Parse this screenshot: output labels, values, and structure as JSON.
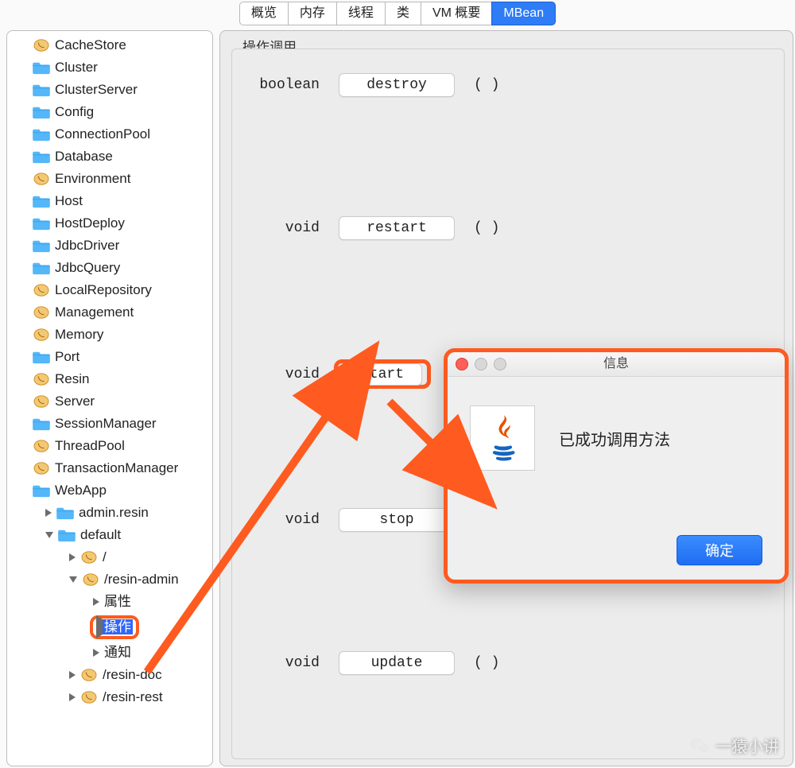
{
  "tabs": {
    "items": [
      "概览",
      "内存",
      "线程",
      "类",
      "VM 概要",
      "MBean"
    ],
    "active_index": 5
  },
  "sidebar": {
    "nodes": [
      {
        "depth": 1,
        "arrow": "none",
        "icon": "bean",
        "label": "CacheStore"
      },
      {
        "depth": 1,
        "arrow": "none",
        "icon": "folder",
        "label": "Cluster"
      },
      {
        "depth": 1,
        "arrow": "none",
        "icon": "folder",
        "label": "ClusterServer"
      },
      {
        "depth": 1,
        "arrow": "none",
        "icon": "folder",
        "label": "Config"
      },
      {
        "depth": 1,
        "arrow": "none",
        "icon": "folder",
        "label": "ConnectionPool"
      },
      {
        "depth": 1,
        "arrow": "none",
        "icon": "folder",
        "label": "Database"
      },
      {
        "depth": 1,
        "arrow": "none",
        "icon": "bean",
        "label": "Environment"
      },
      {
        "depth": 1,
        "arrow": "none",
        "icon": "folder",
        "label": "Host"
      },
      {
        "depth": 1,
        "arrow": "none",
        "icon": "folder",
        "label": "HostDeploy"
      },
      {
        "depth": 1,
        "arrow": "none",
        "icon": "folder",
        "label": "JdbcDriver"
      },
      {
        "depth": 1,
        "arrow": "none",
        "icon": "folder",
        "label": "JdbcQuery"
      },
      {
        "depth": 1,
        "arrow": "none",
        "icon": "bean",
        "label": "LocalRepository"
      },
      {
        "depth": 1,
        "arrow": "none",
        "icon": "bean",
        "label": "Management"
      },
      {
        "depth": 1,
        "arrow": "none",
        "icon": "bean",
        "label": "Memory"
      },
      {
        "depth": 1,
        "arrow": "none",
        "icon": "folder",
        "label": "Port"
      },
      {
        "depth": 1,
        "arrow": "none",
        "icon": "bean",
        "label": "Resin"
      },
      {
        "depth": 1,
        "arrow": "none",
        "icon": "bean",
        "label": "Server"
      },
      {
        "depth": 1,
        "arrow": "none",
        "icon": "folder",
        "label": "SessionManager"
      },
      {
        "depth": 1,
        "arrow": "none",
        "icon": "bean",
        "label": "ThreadPool"
      },
      {
        "depth": 1,
        "arrow": "none",
        "icon": "bean",
        "label": "TransactionManager"
      },
      {
        "depth": 1,
        "arrow": "none",
        "icon": "folder",
        "label": "WebApp"
      },
      {
        "depth": 2,
        "arrow": "closed",
        "icon": "folder",
        "label": "admin.resin"
      },
      {
        "depth": 2,
        "arrow": "open",
        "icon": "folder",
        "label": "default"
      },
      {
        "depth": 3,
        "arrow": "closed",
        "icon": "bean",
        "label": "/"
      },
      {
        "depth": 3,
        "arrow": "open",
        "icon": "bean",
        "label": "/resin-admin"
      },
      {
        "depth": 4,
        "arrow": "closed",
        "icon": "none",
        "label": "属性"
      },
      {
        "depth": 4,
        "arrow": "closed",
        "icon": "none",
        "label": "操作",
        "highlight": true,
        "selected": true
      },
      {
        "depth": 4,
        "arrow": "closed",
        "icon": "none",
        "label": "通知"
      },
      {
        "depth": 3,
        "arrow": "closed",
        "icon": "bean",
        "label": "/resin-doc"
      },
      {
        "depth": 3,
        "arrow": "closed",
        "icon": "bean",
        "label": "/resin-rest"
      }
    ]
  },
  "panel": {
    "group_title": "操作调用",
    "operations": [
      {
        "return_type": "boolean",
        "name": "destroy",
        "args": "( )",
        "highlight": false
      },
      {
        "return_type": "void",
        "name": "restart",
        "args": "( )",
        "highlight": false
      },
      {
        "return_type": "void",
        "name": "start",
        "args": "( )",
        "highlight": true
      },
      {
        "return_type": "void",
        "name": "stop",
        "args": "( )",
        "highlight": false
      },
      {
        "return_type": "void",
        "name": "update",
        "args": "( )",
        "highlight": false
      }
    ]
  },
  "dialog": {
    "title": "信息",
    "message": "已成功调用方法",
    "ok_label": "确定"
  },
  "watermark": {
    "text": "一猿小讲"
  }
}
